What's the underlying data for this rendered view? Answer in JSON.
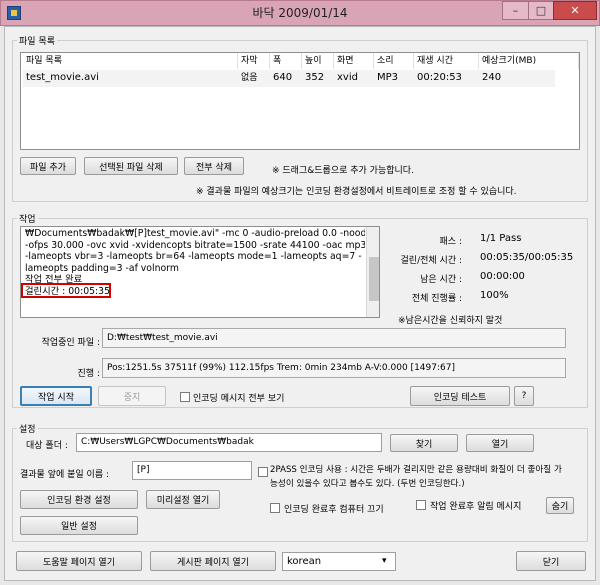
{
  "window": {
    "title": "바닥 2009/01/14",
    "min_label": "–",
    "max_label": "□",
    "close_label": "✕"
  },
  "file_list": {
    "legend": "파일 목록",
    "columns": [
      "파일 목록",
      "자막",
      "폭",
      "높이",
      "화면",
      "소리",
      "재생 시간",
      "예상크기(MB)"
    ],
    "rows": [
      {
        "name": "test_movie.avi",
        "subtitle": "없음",
        "width": "640",
        "height": "352",
        "video": "xvid",
        "audio": "MP3",
        "duration": "00:20:53",
        "size": "240"
      }
    ],
    "add_button": "파일 추가",
    "remove_selected_button": "선택된 파일 삭제",
    "remove_all_button": "전부 삭제",
    "drag_hint": "※ 드래그&드롭으로 추가 가능합니다.",
    "size_hint": "※ 결과물 파일의 예상크기는 인코딩 환경설정에서 비트레이트로 조정 할 수 있습니다."
  },
  "job": {
    "legend": "작업",
    "log_lines": [
      "₩Documents₩badak₩[P]test_movie.avi\" -mc 0 -audio-preload 0.0 -noodml",
      "-ofps 30.000 -ovc xvid -xvidencopts bitrate=1500 -srate 44100 -oac mp3lame",
      "-lameopts vbr=3  -lameopts br=64 -lameopts mode=1 -lameopts aq=7 -",
      "lameopts padding=3 -af volnorm",
      "작업 전부 완료"
    ],
    "elapsed_line": "걸린시간 : 00:05:35",
    "stats": [
      {
        "label": "패스 :",
        "value": "1/1 Pass"
      },
      {
        "label": "걸린/전체 시간 :",
        "value": "00:05:35/00:05:35"
      },
      {
        "label": "남은 시간 :",
        "value": "00:00:00"
      },
      {
        "label": "전체 진행률 :",
        "value": "100%"
      }
    ],
    "remaining_note": "※남은시간을 신뢰하지 말것",
    "current_file_label": "작업중인 파일 :",
    "current_file_value": "D:₩test₩test_movie.avi",
    "progress_label": "진행 :",
    "progress_value": "Pos:1251.5s  37511f (99%) 112.15fps Trem:    0min 234mb  A-V:0.000 [1497:67]",
    "start_button": "작업 시작",
    "stop_button": "중지",
    "show_all_messages_label": "인코딩 메시지 전부 보기",
    "show_all_messages_checked": false,
    "encoding_test_button": "인코딩 테스트",
    "help_button": "?"
  },
  "settings": {
    "legend": "설정",
    "target_folder_label": "대상 폴더 :",
    "target_folder_value": "C:₩Users₩LGPC₩Documents₩badak",
    "find_button": "찾기",
    "open_button": "열기",
    "prefix_label": "결과물 앞에 붙일 이름 :",
    "prefix_value": "[P]",
    "twopass_checked": false,
    "twopass_text_line1": "2PASS 인코딩 사용 : 시간은 두배가 걸리지만 같은 용량대비 화질이 더 좋아질 가",
    "twopass_text_line2": "능성이 있을수 있다고 봅수도 있다. (두번 인코딩한다.)",
    "encoding_settings_button": "인코딩 환경 설정",
    "preset_open_button": "미리설정 열기",
    "shutdown_label": "인코딩 완료후 컴퓨터 끄기",
    "shutdown_checked": false,
    "notify_label": "작업 완료후 알림 메시지",
    "notify_checked": false,
    "hide_button": "숨기",
    "general_settings_button": "일반 설정"
  },
  "footer": {
    "help_page_button": "도움말 페이지 열기",
    "board_page_button": "게시판 페이지 열기",
    "language_selected": "korean",
    "close_button": "닫기"
  },
  "colors": {
    "highlight_box": "#d40000",
    "titlebar": "#d9a5b6",
    "close_button": "#c94b4b"
  }
}
